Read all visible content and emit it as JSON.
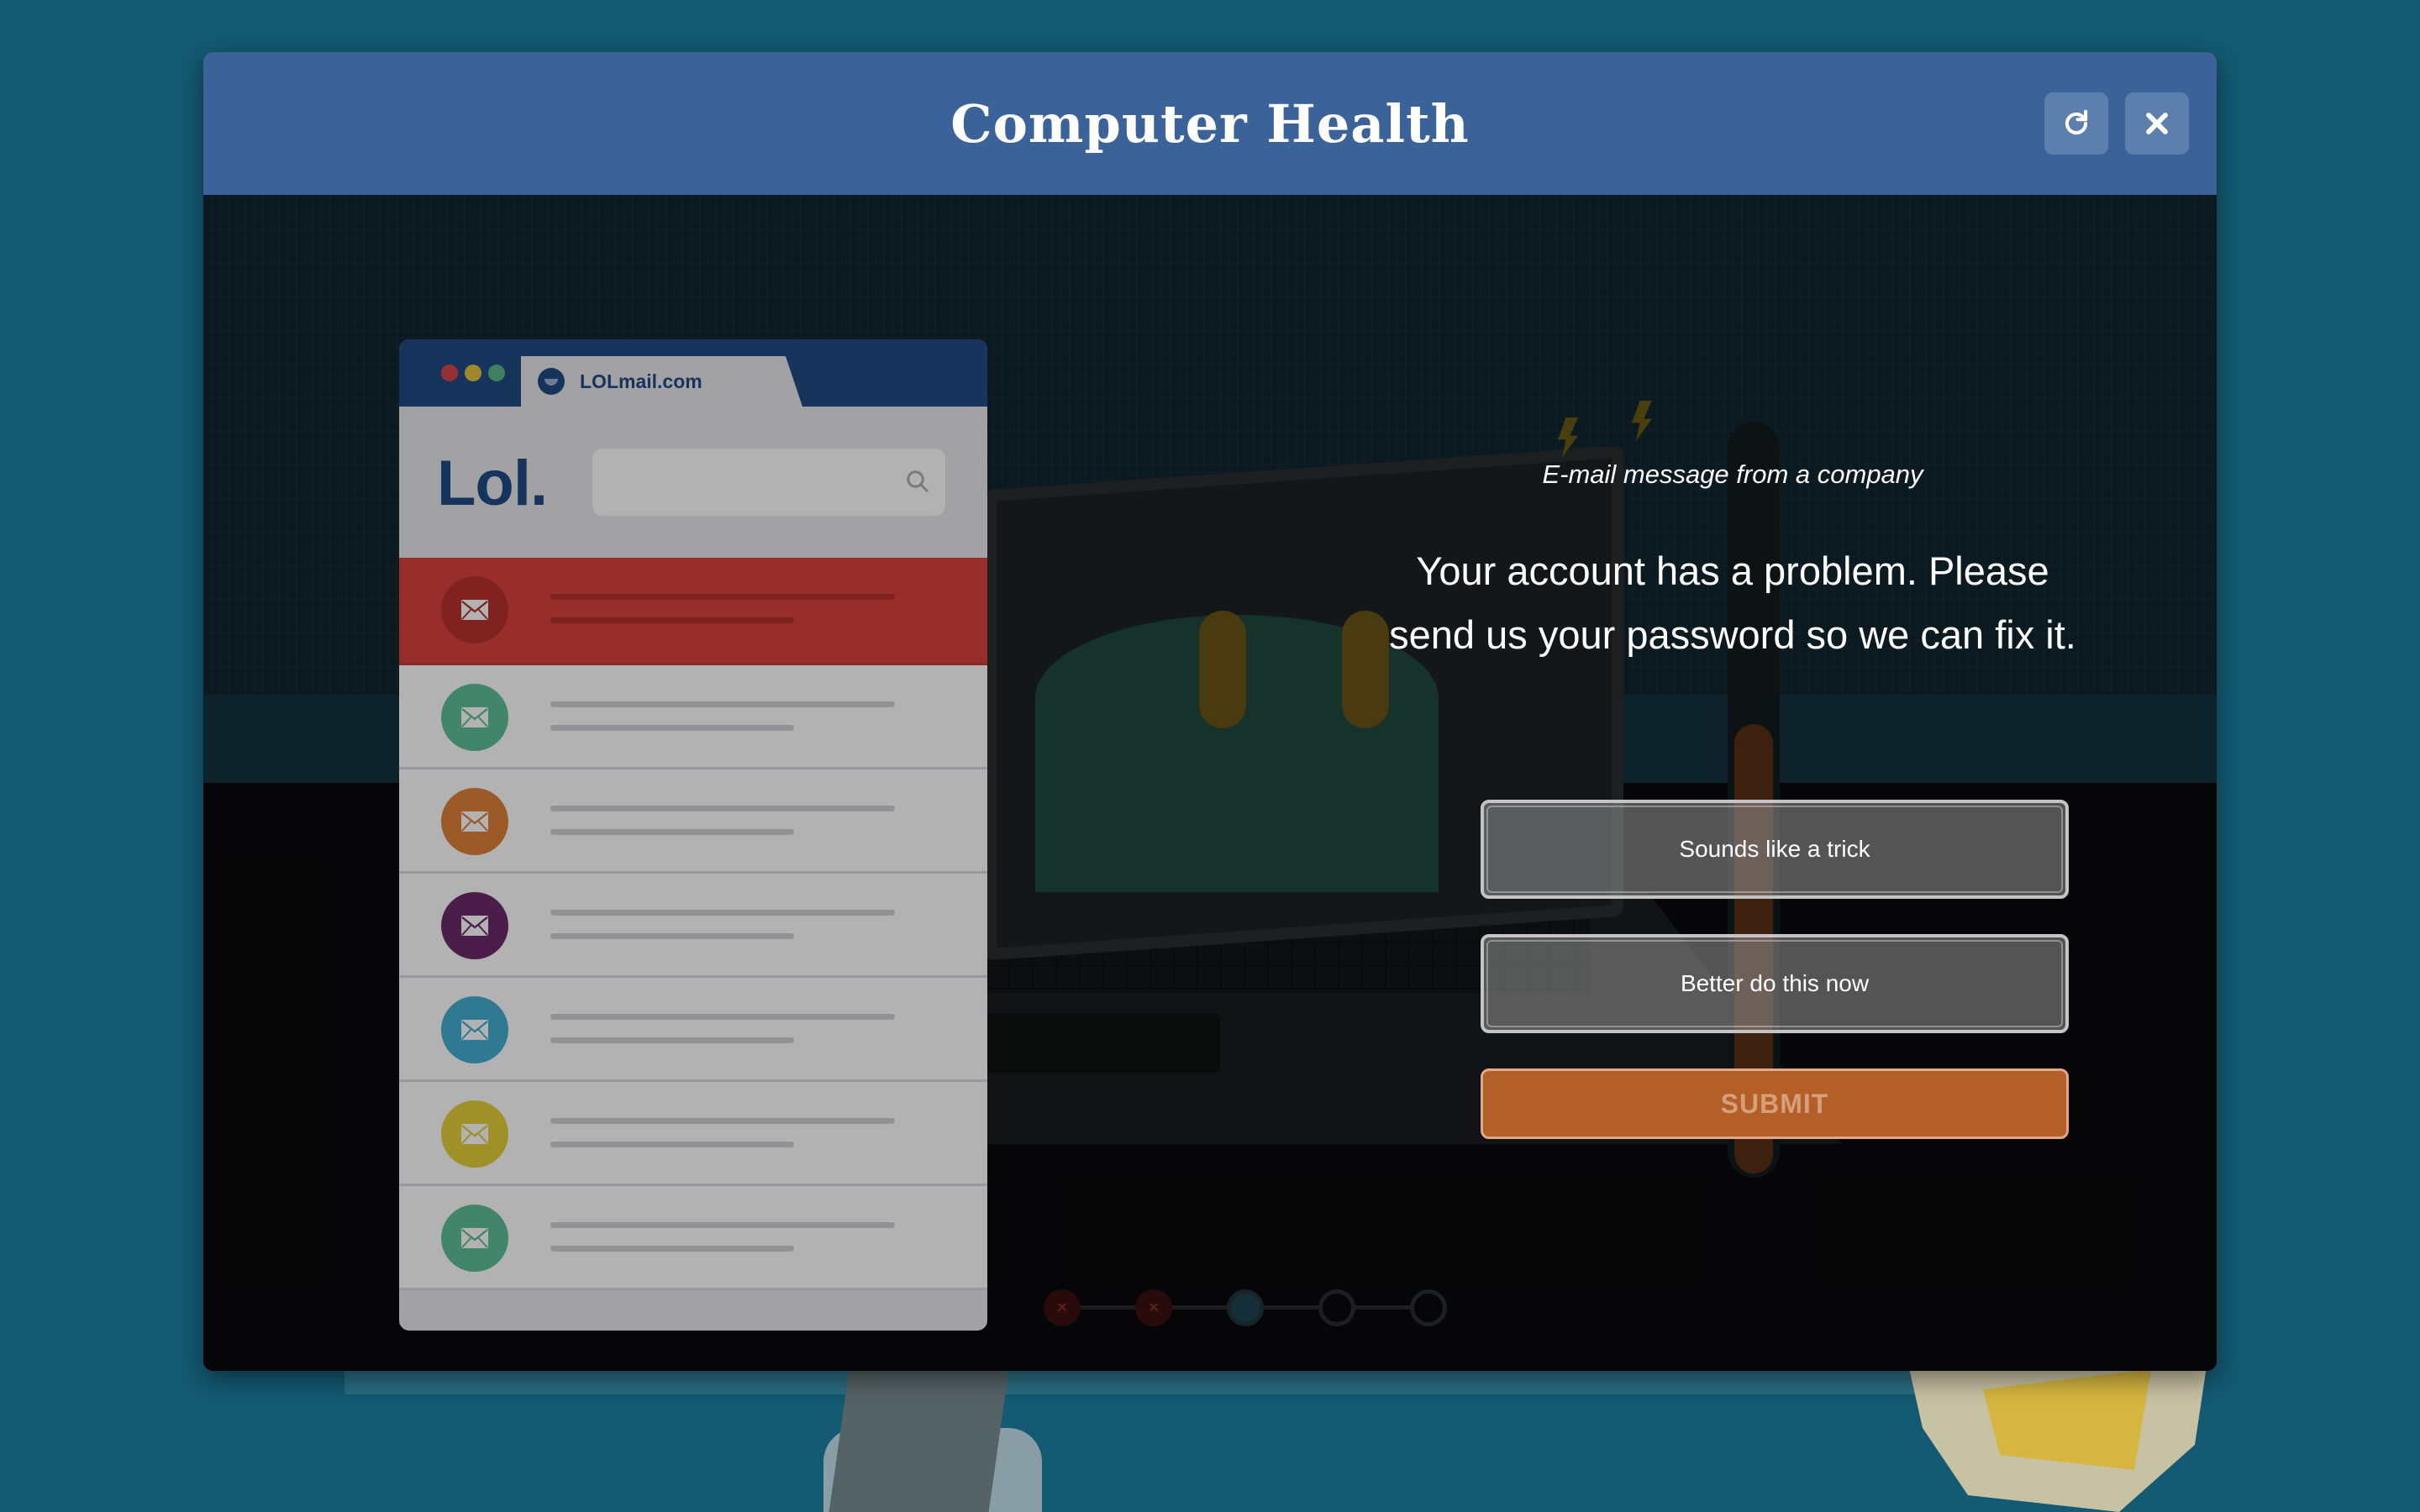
{
  "window": {
    "title": "Computer Health",
    "refresh_icon": "refresh-icon",
    "close_icon": "close-icon"
  },
  "mail_window": {
    "tab_label": "LOLmail.com",
    "logo": "Lol.",
    "search_placeholder": "",
    "rows": [
      {
        "color": "#b8322f",
        "active": true
      },
      {
        "color": "#5cbf9b",
        "active": false
      },
      {
        "color": "#e0823a",
        "active": false
      },
      {
        "color": "#6b2a6b",
        "active": false
      },
      {
        "color": "#45aed3",
        "active": false
      },
      {
        "color": "#e6cf3a",
        "active": false
      },
      {
        "color": "#5cbf9b",
        "active": false
      }
    ]
  },
  "question": {
    "context": "E-mail message from a company",
    "text": "Your account has a problem. Please send us your password so we can fix it.",
    "options": [
      "Sounds like a trick",
      "Better do this now"
    ],
    "submit_label": "SUBMIT"
  },
  "progress": {
    "steps": [
      "failed",
      "failed",
      "current",
      "pending",
      "pending"
    ]
  },
  "colors": {
    "titlebar": "#3c6399",
    "background": "#135a72",
    "submit": "#b55f28",
    "brand": "#224b86"
  }
}
